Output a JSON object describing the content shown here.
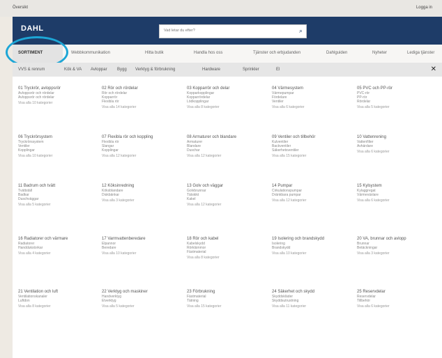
{
  "topbar": {
    "left": "Översikt",
    "right": "Logga in"
  },
  "header": {
    "logo": "DAHL",
    "search_placeholder": "Vad letar du efter?"
  },
  "nav": {
    "active": "SORTIMENT",
    "items": [
      "Webbkommunikation",
      "Hitta butik",
      "Handla hos oss",
      "Tjänster och erbjudanden",
      "Dahlguiden",
      "Nyheter",
      "Lediga tjänster"
    ]
  },
  "subnav": {
    "items": [
      "VVS & renrum",
      "Kök & VA",
      "Avloppar",
      "Bygg",
      "Verktyg & förbrukning",
      "Hardware",
      "Sprinkler",
      "El"
    ],
    "close": "✕"
  },
  "categories": [
    {
      "title": "01 Tryckrör, avloppsrör",
      "lines": [
        "Avloppsrör och rördelar",
        "Avloppsrör och rördelar"
      ],
      "more": "Visa alla 10 kategorier"
    },
    {
      "title": "02 Rör och rördelar",
      "lines": [
        "Rör och rördelar",
        "Kopparrör",
        "Flexibla rör"
      ],
      "more": "Visa alla 14 kategorier"
    },
    {
      "title": "03 Kopparrör och delar",
      "lines": [
        "Kopparkopplingar",
        "Kopparrördelar",
        "Lödkopplingar"
      ],
      "more": "Visa alla 8 kategorier"
    },
    {
      "title": "04 Värmesystem",
      "lines": [
        "Värmepumpar",
        "Fördelare",
        "Ventiler"
      ],
      "more": "Visa alla 6 kategorier"
    },
    {
      "title": "05 PVC och PP-rör",
      "lines": [
        "PVC-rör",
        "PP-rör",
        "Rördelar"
      ],
      "more": "Visa alla 5 kategorier"
    },
    {
      "title": "06 Tryckrörsystem",
      "lines": [
        "Tryckrörssystem",
        "Ventiler",
        "Kopplingar"
      ],
      "more": "Visa alla 10 kategorier"
    },
    {
      "title": "07 Flexibla rör och koppling",
      "lines": [
        "Flexibla rör",
        "Slangar",
        "Kopplingar"
      ],
      "more": "Visa alla 12 kategorier"
    },
    {
      "title": "08 Armaturer och blandare",
      "lines": [
        "Armaturer",
        "Blandare",
        "Duschar"
      ],
      "more": "Visa alla 12 kategorier"
    },
    {
      "title": "09 Ventiler och tillbehör",
      "lines": [
        "Kulventiler",
        "Backventiler",
        "Säkerhetsventiler"
      ],
      "more": "Visa alla 15 kategorier"
    },
    {
      "title": "10 Vattenrening",
      "lines": [
        "Vattenfilter",
        "Avhärdare"
      ],
      "more": "Visa alla 6 kategorier"
    },
    {
      "title": "11 Badrum och tvätt",
      "lines": [
        "Tvättställ",
        "Badkar",
        "Duschväggar"
      ],
      "more": "Visa alla 5 kategorier"
    },
    {
      "title": "12 Köksinredning",
      "lines": [
        "Köksblandare",
        "Diskbänkar"
      ],
      "more": "Visa alla 3 kategorier"
    },
    {
      "title": "13 Golv och väggar",
      "lines": [
        "Golvbrunnar",
        "Tätskikt",
        "Kakel"
      ],
      "more": "Visa alla 12 kategorier"
    },
    {
      "title": "14 Pumpar",
      "lines": [
        "Cirkulationspumpar",
        "Dränkbara pumpar"
      ],
      "more": "Visa alla 12 kategorier"
    },
    {
      "title": "15 Kylsystem",
      "lines": [
        "Kylaggregat",
        "Värmeväxlare"
      ],
      "more": "Visa alla 6 kategorier"
    },
    {
      "title": "16 Radiatorer och värmare",
      "lines": [
        "Radiatorer",
        "Handdukstorkar"
      ],
      "more": "Visa alla 4 kategorier"
    },
    {
      "title": "17 Varmvattenberedare",
      "lines": [
        "Elpannor",
        "Beredare"
      ],
      "more": "Visa alla 10 kategorier"
    },
    {
      "title": "18 Rör och kabel",
      "lines": [
        "Kabelskydd",
        "Rörklämmor",
        "Fästmaterial"
      ],
      "more": "Visa alla 8 kategorier"
    },
    {
      "title": "19 Isolering och brandskydd",
      "lines": [
        "Isolering",
        "Brandskydd"
      ],
      "more": "Visa alla 10 kategorier"
    },
    {
      "title": "20 VA, brunnar och avlopp",
      "lines": [
        "Brunnar",
        "Betäckningar"
      ],
      "more": "Visa alla 3 kategorier"
    },
    {
      "title": "21 Ventilation och luft",
      "lines": [
        "Ventilationskanaler",
        "Luftdon"
      ],
      "more": "Visa alla 8 kategorier"
    },
    {
      "title": "22 Verktyg och maskiner",
      "lines": [
        "Handverktyg",
        "Elverktyg"
      ],
      "more": "Visa alla 5 kategorier"
    },
    {
      "title": "23 Förbrukning",
      "lines": [
        "Fästmaterial",
        "Tätning"
      ],
      "more": "Visa alla 15 kategorier"
    },
    {
      "title": "24 Säkerhet och skydd",
      "lines": [
        "Skyddskläder",
        "Skyddsutrustning"
      ],
      "more": "Visa alla 11 kategorier"
    },
    {
      "title": "25 Reservdelar",
      "lines": [
        "Reservdelar",
        "Tillbehör"
      ],
      "more": "Visa alla 6 kategorier"
    }
  ],
  "colors": {
    "header": "#1e3c68",
    "accent_circle": "#1da6d6"
  },
  "icons": {
    "search": "search-icon",
    "close": "close-icon"
  }
}
